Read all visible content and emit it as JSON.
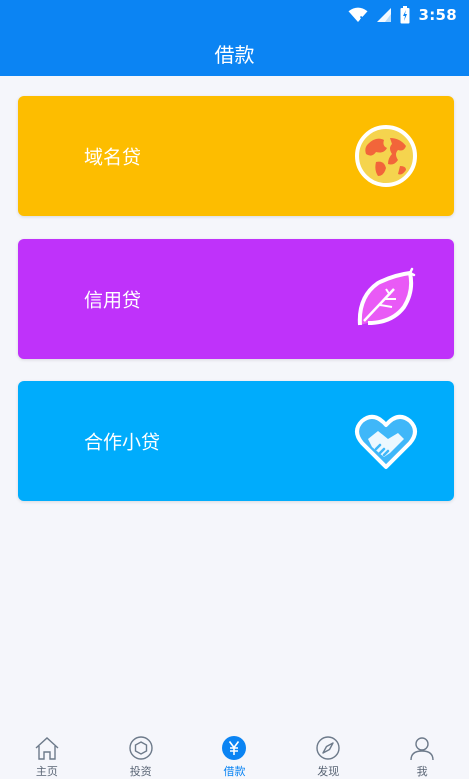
{
  "status_bar": {
    "time": "3:58"
  },
  "app_bar": {
    "title": "借款"
  },
  "cards": [
    {
      "label": "域名贷",
      "color": "#fdbd00",
      "icon": "globe-icon"
    },
    {
      "label": "信用贷",
      "color": "#bf32fa",
      "icon": "leaf-icon"
    },
    {
      "label": "合作小贷",
      "color": "#00acfc",
      "icon": "handshake-heart-icon"
    }
  ],
  "tab_bar": {
    "active_index": 2,
    "active_color": "#0b84f3",
    "tabs": [
      {
        "label": "主页",
        "icon": "home-icon"
      },
      {
        "label": "投资",
        "icon": "invest-icon"
      },
      {
        "label": "借款",
        "icon": "yen-icon"
      },
      {
        "label": "发现",
        "icon": "compass-icon"
      },
      {
        "label": "我",
        "icon": "user-icon"
      }
    ]
  }
}
